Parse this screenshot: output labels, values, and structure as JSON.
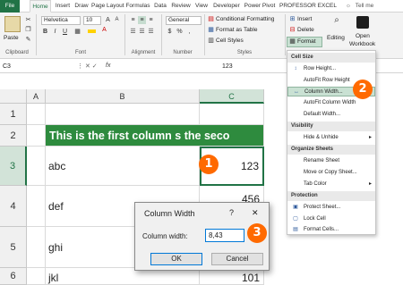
{
  "tabs": [
    "File",
    "Home",
    "Insert",
    "Draw",
    "Page Layout",
    "Formulas",
    "Data",
    "Review",
    "View",
    "Developer",
    "Power Pivot",
    "PROFESSOR EXCEL",
    "Tell me"
  ],
  "ribbon": {
    "paste": "Paste",
    "font_name": "Helvetica",
    "font_size": "10",
    "bold": "B",
    "italic": "I",
    "underline": "U",
    "number_format": "General",
    "conditional_formatting": "Conditional Formatting",
    "format_as_table": "Format as Table",
    "cell_styles": "Cell Styles",
    "insert": "Insert",
    "delete": "Delete",
    "format": "Format",
    "editing": "Editing",
    "open_workbook_line1": "Open",
    "open_workbook_line2": "Workbook",
    "groups": [
      "Clipboard",
      "Font",
      "Alignment",
      "Number",
      "Styles"
    ]
  },
  "formula_bar": {
    "name_box": "C3",
    "fx": "fx",
    "content": "123"
  },
  "grid": {
    "columns": [
      "A",
      "B",
      "C"
    ],
    "rows": [
      "1",
      "2",
      "3",
      "4",
      "5",
      "6"
    ],
    "banner_text": "This is the first column s the seco",
    "cells": [
      "abc",
      "def",
      "ghi",
      "jkl"
    ],
    "c3_value": "123",
    "c4_partial": "456",
    "c6_value": "101"
  },
  "menu": {
    "sections": {
      "cell_size": "Cell Size",
      "visibility": "Visibility",
      "organize": "Organize Sheets",
      "protection": "Protection"
    },
    "items": {
      "row_height": "Row Height...",
      "autofit_row": "AutoFit Row Height",
      "column_width": "Column Width...",
      "autofit_column": "AutoFit Column Width",
      "default_width": "Default Width...",
      "hide_unhide": "Hide & Unhide",
      "rename_sheet": "Rename Sheet",
      "move_copy": "Move or Copy Sheet...",
      "tab_color": "Tab Color",
      "protect_sheet": "Protect Sheet...",
      "lock_cell": "Lock Cell",
      "format_cells": "Format Cells..."
    }
  },
  "dialog": {
    "title": "Column Width",
    "help": "?",
    "close": "✕",
    "label": "Column width:",
    "value": "8,43",
    "ok": "OK",
    "cancel": "Cancel"
  },
  "badges": [
    "1",
    "2",
    "3"
  ],
  "colors": {
    "excel_green": "#217346",
    "badge_orange": "#ff6a00",
    "banner_green": "#2e8b3e"
  }
}
